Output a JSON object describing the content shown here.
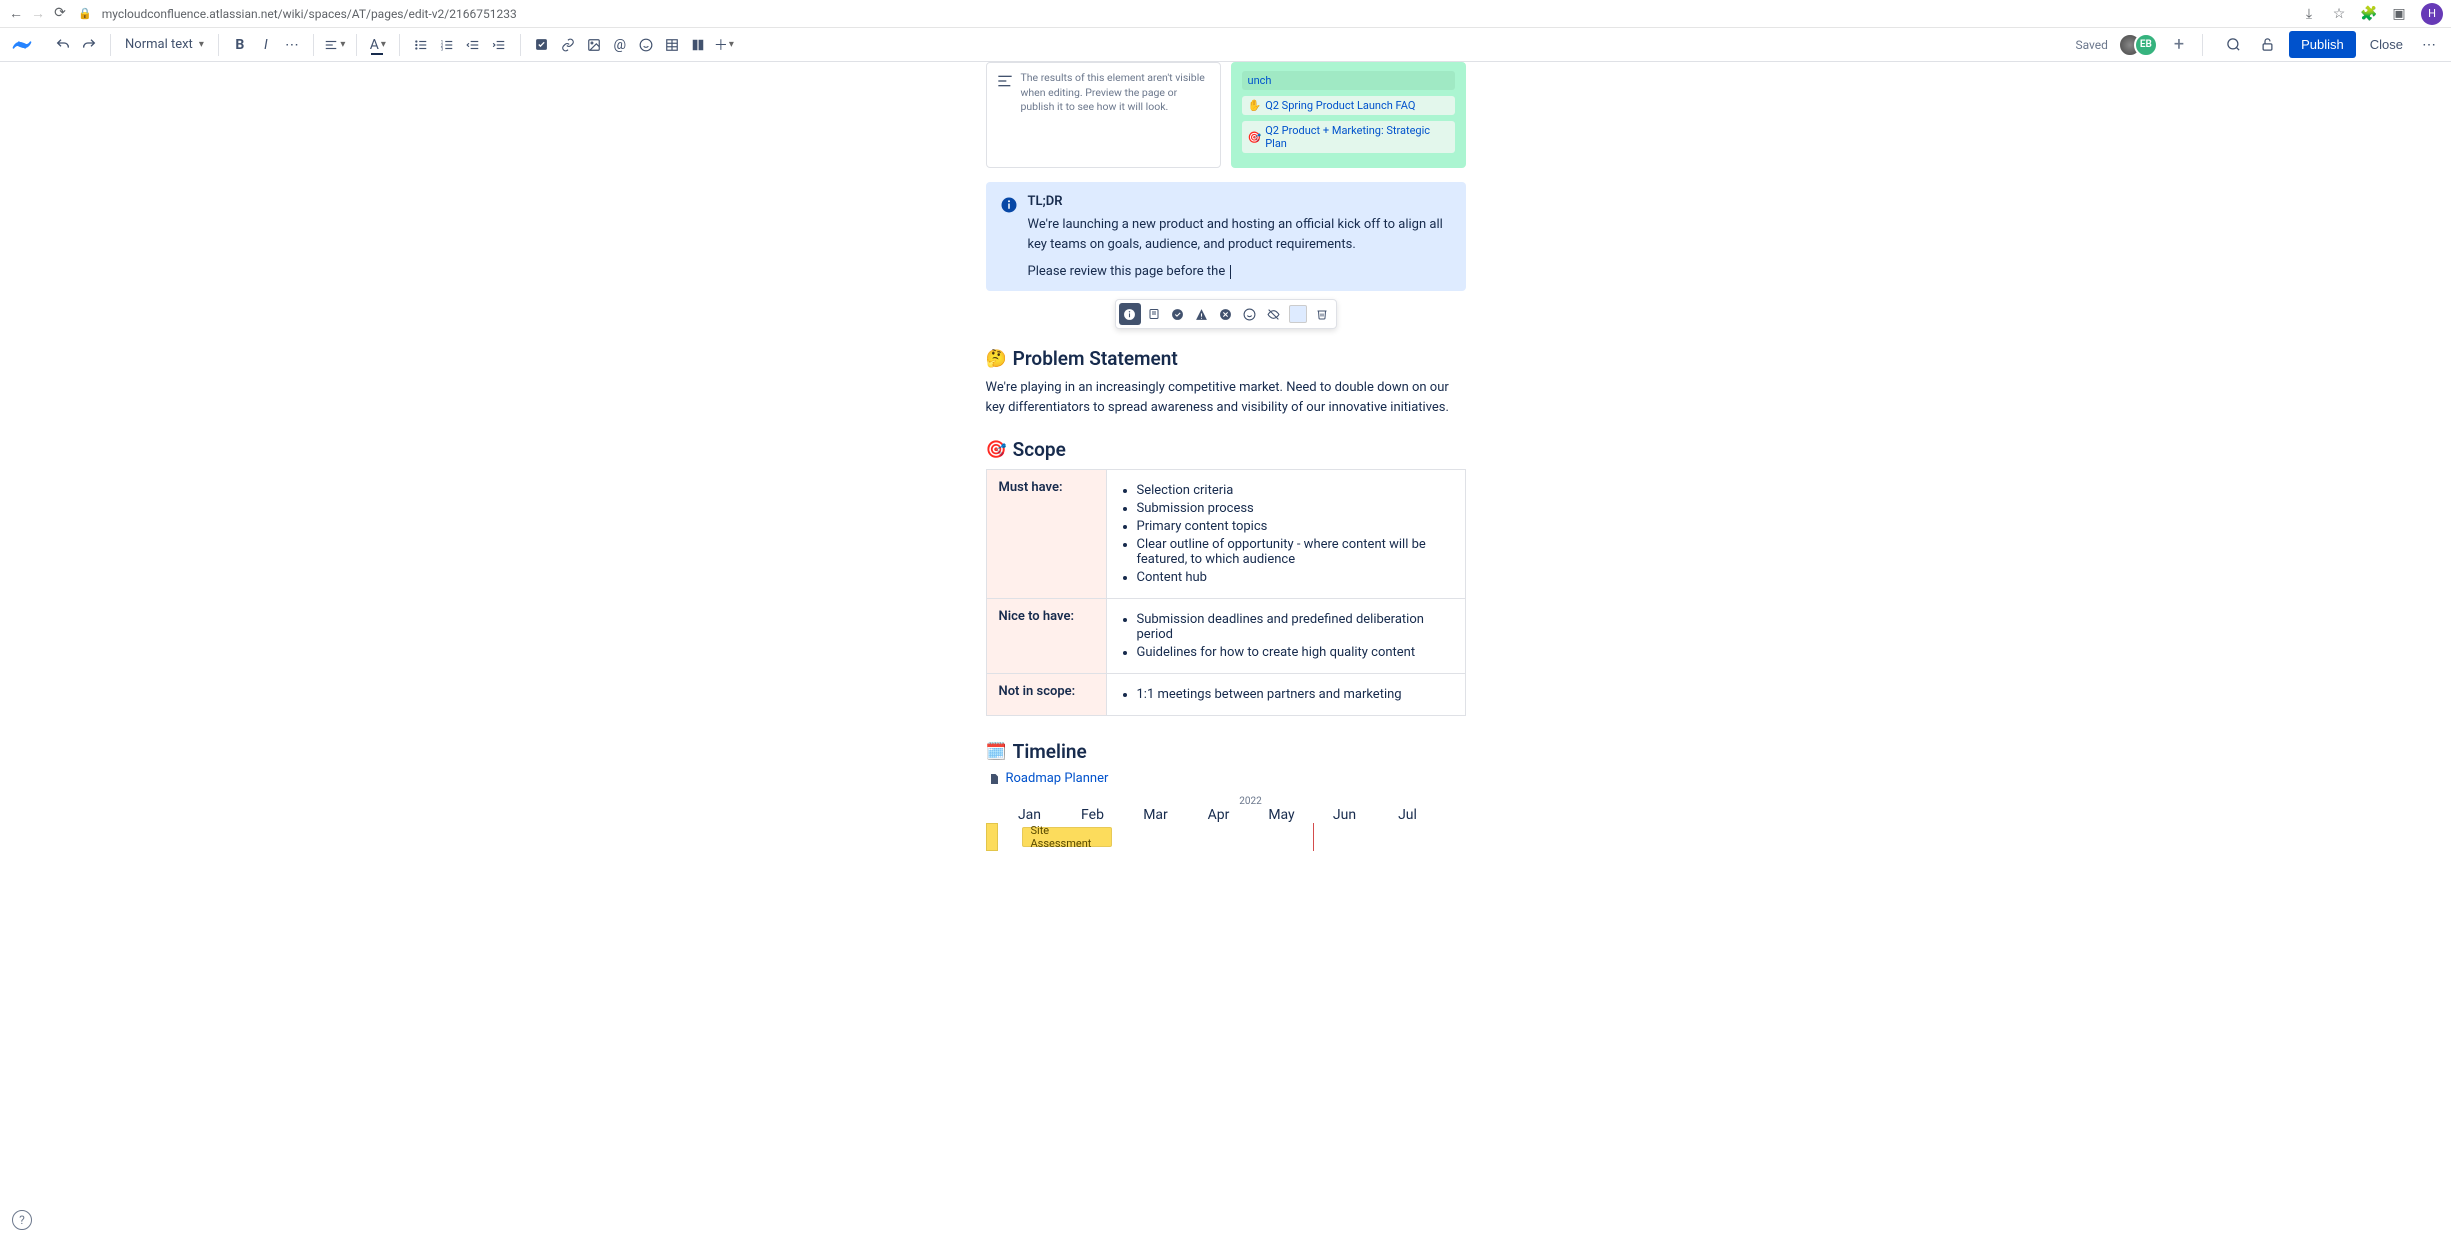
{
  "browser": {
    "url": "mycloudconfluence.atlassian.net/wiki/spaces/AT/pages/edit-v2/2166751233",
    "avatar_letter": "H"
  },
  "toolbar": {
    "text_style": "Normal text",
    "saved": "Saved",
    "collab1": "",
    "collab2": "EB",
    "publish": "Publish",
    "close": "Close"
  },
  "toc": {
    "message": "The results of this element aren't visible when editing. Preview the page or publish it to see how it will look."
  },
  "related": {
    "items": [
      {
        "emoji": "",
        "label": "unch"
      },
      {
        "emoji": "✋",
        "label": "Q2 Spring Product Launch FAQ"
      },
      {
        "emoji": "🎯",
        "label": "Q2 Product + Marketing: Strategic Plan"
      }
    ]
  },
  "tldr": {
    "title": "TL;DR",
    "para1": "We're launching a new product and hosting an official kick off to align all key teams on goals, audience, and product requirements.",
    "para2": "Please review this page before the "
  },
  "sections": {
    "problem": {
      "emoji": "🤔",
      "title": "Problem Statement",
      "body": "We're playing in an increasingly competitive market. Need to double down on our key differentiators to spread awareness and visibility of our innovative initiatives."
    },
    "scope": {
      "emoji": "🎯",
      "title": "Scope",
      "rows": [
        {
          "label": "Must have:",
          "items": [
            "Selection criteria",
            "Submission process",
            "Primary content topics",
            "Clear outline of opportunity - where content will be featured, to which audience",
            "Content hub"
          ]
        },
        {
          "label": "Nice to have:",
          "items": [
            "Submission deadlines and predefined deliberation period",
            "Guidelines for how to create high quality content"
          ]
        },
        {
          "label": "Not in scope:",
          "items": [
            "1:1 meetings between partners and marketing"
          ]
        }
      ]
    },
    "timeline": {
      "emoji": "🗓️",
      "title": "Timeline",
      "roadmap_link": "Roadmap Planner",
      "year": "2022",
      "months": [
        "Jan",
        "Feb",
        "Mar",
        "Apr",
        "May",
        "Jun",
        "Jul"
      ],
      "bar1": "Site Assessment"
    }
  },
  "help": "?"
}
